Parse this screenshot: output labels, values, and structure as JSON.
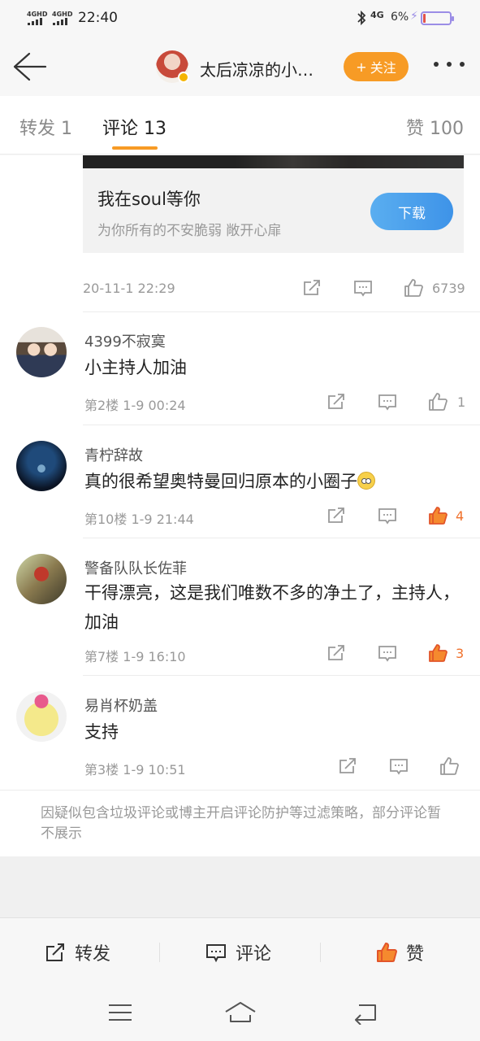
{
  "status_bar": {
    "sim1": "4GHD",
    "sim2": "4GHD",
    "time": "22:40",
    "network": "4G",
    "battery_percent": "6%",
    "battery_level": 0.06,
    "battery_color": "#9b8de6"
  },
  "header": {
    "author_name": "太后凉凉的小…",
    "follow_label": "关注",
    "follow_color": "#f79b25"
  },
  "tabs": {
    "forward": "转发 1",
    "comment": "评论 13",
    "like": "赞 100",
    "active": "comment"
  },
  "ad": {
    "title": "我在soul等你",
    "subtitle": "为你所有的不安脆弱 敞开心扉",
    "button": "下载"
  },
  "post": {
    "timestamp": "20-11-1 22:29",
    "like_count": "6739"
  },
  "comments": [
    {
      "name": "4399不寂寞",
      "text": "小主持人加油",
      "floor": "第2楼",
      "time": "1-9 00:24",
      "likes": "1",
      "liked": false
    },
    {
      "name": "青柠辞故",
      "text": "真的很希望奥特曼回归原本的小圈子",
      "emoji": "dizzy-face-emoji",
      "floor": "第10楼",
      "time": "1-9 21:44",
      "likes": "4",
      "liked": true
    },
    {
      "name": "警备队队长佐菲",
      "text": "干得漂亮，这是我们唯数不多的净土了，主持人，加油",
      "floor": "第7楼",
      "time": "1-9 16:10",
      "likes": "3",
      "liked": true
    },
    {
      "name": "易肖杯奶盖",
      "text": "支持",
      "floor": "第3楼",
      "time": "1-9 10:51",
      "likes": "",
      "liked": false
    }
  ],
  "filter_note": "因疑似包含垃圾评论或博主开启评论防护等过滤策略，部分评论暂不展示",
  "action_bar": {
    "forward": "转发",
    "comment": "评论",
    "like": "赞",
    "liked": true,
    "like_color": "#f2662c"
  },
  "nav": {
    "items": [
      "menu-icon",
      "home-icon",
      "back-icon"
    ]
  }
}
